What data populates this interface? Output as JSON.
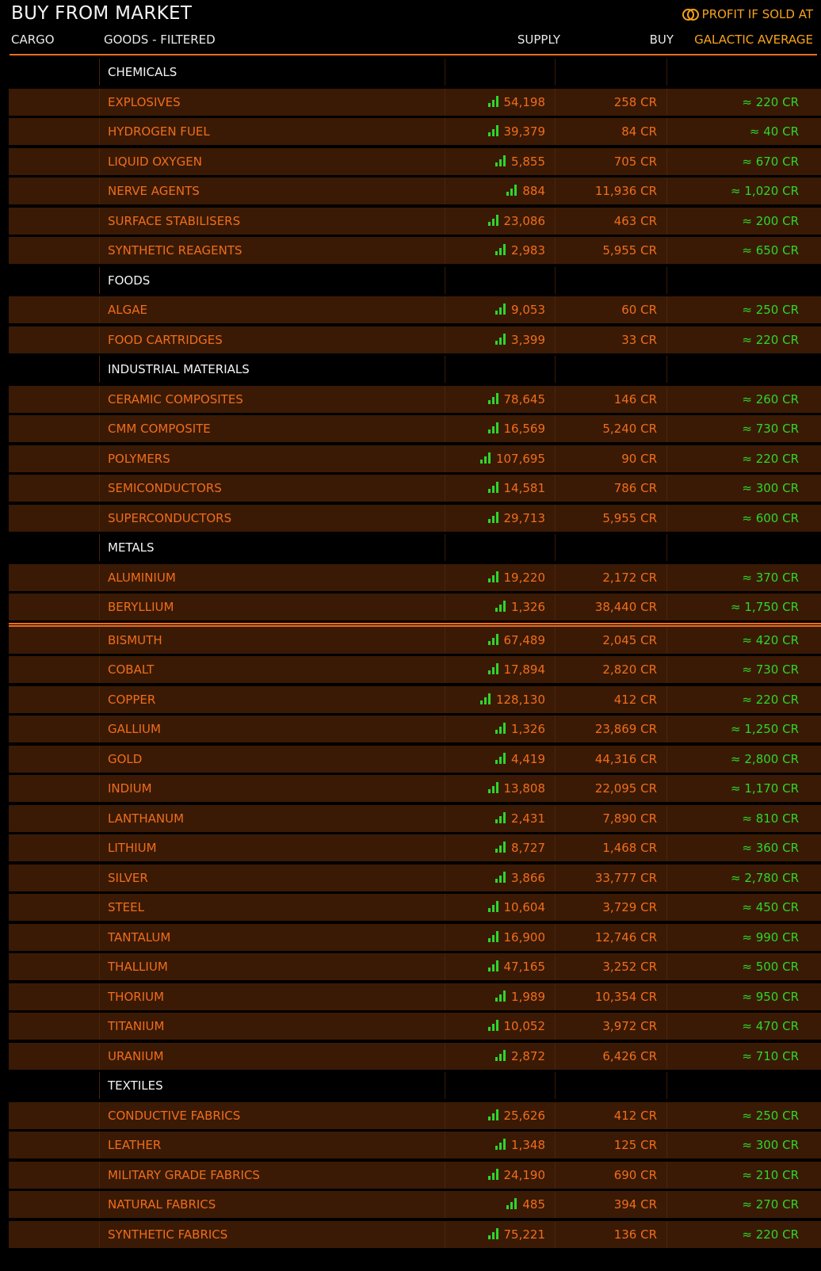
{
  "title": "BUY FROM MARKET",
  "profit_hint": "PROFIT IF SOLD AT",
  "icons": {
    "profit": "coin-stack-icon",
    "supply": "signal-bars-icon"
  },
  "colors": {
    "accent": "#f06d1b",
    "positive": "#2fd62a",
    "highlight": "#f7a21b",
    "row_bg": "#3a1a05"
  },
  "columns": {
    "cargo": "CARGO",
    "goods": "GOODS - FILTERED",
    "supply": "SUPPLY",
    "buy": "BUY",
    "galactic_average": "GALACTIC AVERAGE"
  },
  "rows": [
    {
      "type": "category",
      "name": "CHEMICALS"
    },
    {
      "type": "item",
      "name": "EXPLOSIVES",
      "supply": "54,198",
      "buy": "258 CR",
      "avg": "≈ 220 CR"
    },
    {
      "type": "item",
      "name": "HYDROGEN FUEL",
      "supply": "39,379",
      "buy": "84 CR",
      "avg": "≈ 40 CR"
    },
    {
      "type": "item",
      "name": "LIQUID OXYGEN",
      "supply": "5,855",
      "buy": "705 CR",
      "avg": "≈ 670 CR"
    },
    {
      "type": "item",
      "name": "NERVE AGENTS",
      "supply": "884",
      "buy": "11,936 CR",
      "avg": "≈ 1,020 CR"
    },
    {
      "type": "item",
      "name": "SURFACE STABILISERS",
      "supply": "23,086",
      "buy": "463 CR",
      "avg": "≈ 200 CR"
    },
    {
      "type": "item",
      "name": "SYNTHETIC REAGENTS",
      "supply": "2,983",
      "buy": "5,955 CR",
      "avg": "≈ 650 CR"
    },
    {
      "type": "category",
      "name": "FOODS"
    },
    {
      "type": "item",
      "name": "ALGAE",
      "supply": "9,053",
      "buy": "60 CR",
      "avg": "≈ 250 CR"
    },
    {
      "type": "item",
      "name": "FOOD CARTRIDGES",
      "supply": "3,399",
      "buy": "33 CR",
      "avg": "≈ 220 CR"
    },
    {
      "type": "category",
      "name": "INDUSTRIAL MATERIALS"
    },
    {
      "type": "item",
      "name": "CERAMIC COMPOSITES",
      "supply": "78,645",
      "buy": "146 CR",
      "avg": "≈ 260 CR"
    },
    {
      "type": "item",
      "name": "CMM COMPOSITE",
      "supply": "16,569",
      "buy": "5,240 CR",
      "avg": "≈ 730 CR"
    },
    {
      "type": "item",
      "name": "POLYMERS",
      "supply": "107,695",
      "buy": "90 CR",
      "avg": "≈ 220 CR"
    },
    {
      "type": "item",
      "name": "SEMICONDUCTORS",
      "supply": "14,581",
      "buy": "786 CR",
      "avg": "≈ 300 CR"
    },
    {
      "type": "item",
      "name": "SUPERCONDUCTORS",
      "supply": "29,713",
      "buy": "5,955 CR",
      "avg": "≈ 600 CR"
    },
    {
      "type": "category",
      "name": "METALS"
    },
    {
      "type": "item",
      "name": "ALUMINIUM",
      "supply": "19,220",
      "buy": "2,172 CR",
      "avg": "≈ 370 CR"
    },
    {
      "type": "item",
      "name": "BERYLLIUM",
      "supply": "1,326",
      "buy": "38,440 CR",
      "avg": "≈ 1,750 CR"
    },
    {
      "type": "item",
      "name": "BISMUTH",
      "supply": "67,489",
      "buy": "2,045 CR",
      "avg": "≈ 420 CR"
    },
    {
      "type": "item",
      "name": "COBALT",
      "supply": "17,894",
      "buy": "2,820 CR",
      "avg": "≈ 730 CR"
    },
    {
      "type": "item",
      "name": "COPPER",
      "supply": "128,130",
      "buy": "412 CR",
      "avg": "≈ 220 CR"
    },
    {
      "type": "item",
      "name": "GALLIUM",
      "supply": "1,326",
      "buy": "23,869 CR",
      "avg": "≈ 1,250 CR"
    },
    {
      "type": "item",
      "name": "GOLD",
      "supply": "4,419",
      "buy": "44,316 CR",
      "avg": "≈ 2,800 CR"
    },
    {
      "type": "item",
      "name": "INDIUM",
      "supply": "13,808",
      "buy": "22,095 CR",
      "avg": "≈ 1,170 CR"
    },
    {
      "type": "item",
      "name": "LANTHANUM",
      "supply": "2,431",
      "buy": "7,890 CR",
      "avg": "≈ 810 CR"
    },
    {
      "type": "item",
      "name": "LITHIUM",
      "supply": "8,727",
      "buy": "1,468 CR",
      "avg": "≈ 360 CR"
    },
    {
      "type": "item",
      "name": "SILVER",
      "supply": "3,866",
      "buy": "33,777 CR",
      "avg": "≈ 2,780 CR"
    },
    {
      "type": "item",
      "name": "STEEL",
      "supply": "10,604",
      "buy": "3,729 CR",
      "avg": "≈ 450 CR"
    },
    {
      "type": "item",
      "name": "TANTALUM",
      "supply": "16,900",
      "buy": "12,746 CR",
      "avg": "≈ 990 CR"
    },
    {
      "type": "item",
      "name": "THALLIUM",
      "supply": "47,165",
      "buy": "3,252 CR",
      "avg": "≈ 500 CR"
    },
    {
      "type": "item",
      "name": "THORIUM",
      "supply": "1,989",
      "buy": "10,354 CR",
      "avg": "≈ 950 CR"
    },
    {
      "type": "item",
      "name": "TITANIUM",
      "supply": "10,052",
      "buy": "3,972 CR",
      "avg": "≈ 470 CR"
    },
    {
      "type": "item",
      "name": "URANIUM",
      "supply": "2,872",
      "buy": "6,426 CR",
      "avg": "≈ 710 CR"
    },
    {
      "type": "category",
      "name": "TEXTILES"
    },
    {
      "type": "item",
      "name": "CONDUCTIVE FABRICS",
      "supply": "25,626",
      "buy": "412 CR",
      "avg": "≈ 250 CR"
    },
    {
      "type": "item",
      "name": "LEATHER",
      "supply": "1,348",
      "buy": "125 CR",
      "avg": "≈ 300 CR"
    },
    {
      "type": "item",
      "name": "MILITARY GRADE FABRICS",
      "supply": "24,190",
      "buy": "690 CR",
      "avg": "≈ 210 CR"
    },
    {
      "type": "item",
      "name": "NATURAL FABRICS",
      "supply": "485",
      "buy": "394 CR",
      "avg": "≈ 270 CR"
    },
    {
      "type": "item",
      "name": "SYNTHETIC FABRICS",
      "supply": "75,221",
      "buy": "136 CR",
      "avg": "≈ 220 CR"
    }
  ]
}
